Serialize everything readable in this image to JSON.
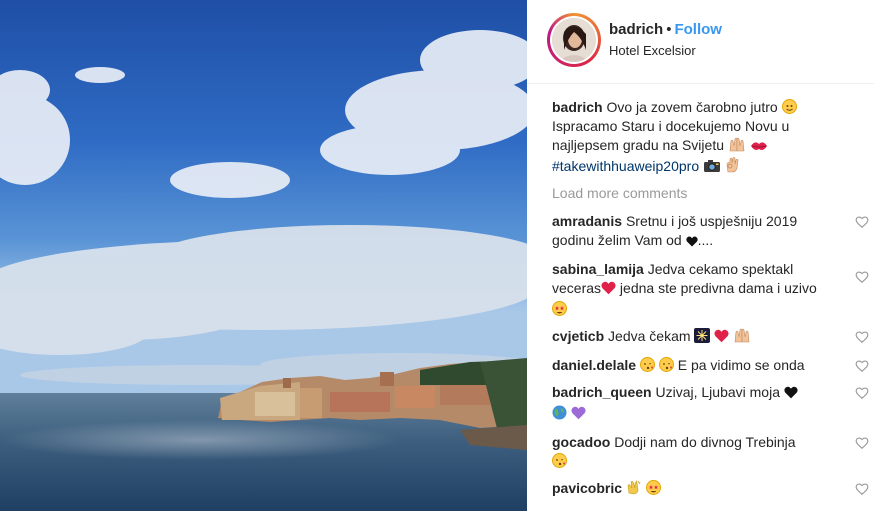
{
  "post": {
    "username": "badrich",
    "separator": "•",
    "follow_label": "Follow",
    "location": "Hotel Excelsior"
  },
  "caption": {
    "username": "badrich",
    "text": "Ovo ja zovem čarobno jutro",
    "text2": "Ispracamo Staru i docekujemo Novu u najljepsem gradu na Svijetu",
    "hashtag": "#takewithhuaweip20pro"
  },
  "load_more_label": "Load more comments",
  "comments": [
    {
      "username": "amradanis",
      "text": "Sretnu i još uspješniju 2019 godinu želim Vam od",
      "tail": "...."
    },
    {
      "username": "sabina_lamija",
      "text": "Jedva cekamo spektakl veceras",
      "text2": "jedna ste predivna dama i uzivo"
    },
    {
      "username": "cvjeticb",
      "text": "Jedva čekam"
    },
    {
      "username": "daniel.delale",
      "text": "E pa vidimo se onda"
    },
    {
      "username": "badrich_queen",
      "text": "Uzivaj, Ljubavi moja"
    },
    {
      "username": "gocadoo",
      "text": "Dodji nam do divnog Trebinja"
    },
    {
      "username": "pavicobric",
      "text": ""
    }
  ],
  "colors": {
    "accent": "#3897f0",
    "hashtag": "#003569",
    "muted": "#999999",
    "text": "#262626"
  },
  "icons": [
    "heart-outline-icon",
    "avatar",
    "emoji"
  ]
}
